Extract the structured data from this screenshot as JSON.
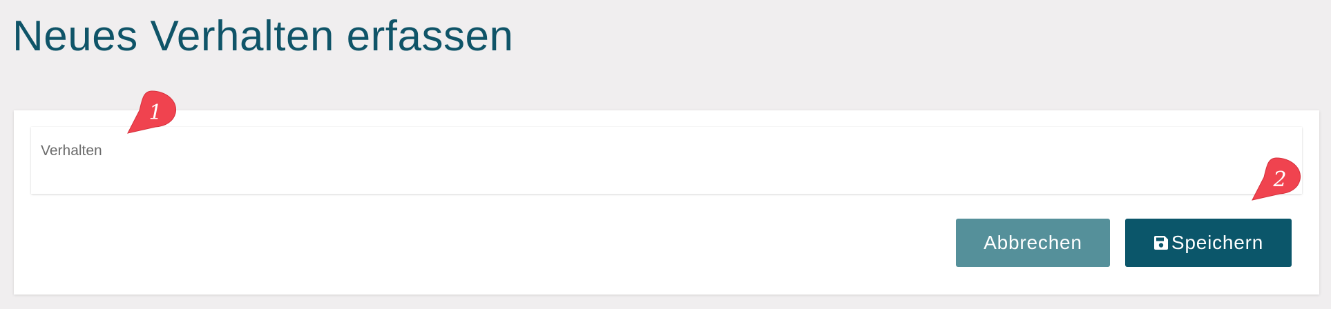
{
  "page": {
    "title": "Neues Verhalten erfassen"
  },
  "form": {
    "field_label": "Verhalten",
    "field_value": ""
  },
  "buttons": {
    "cancel_label": "Abbrechen",
    "save_label": "Speichern",
    "save_icon": "floppy-disk-icon"
  },
  "annotations": [
    {
      "number": "1",
      "target": "verhalten-field"
    },
    {
      "number": "2",
      "target": "save-button"
    }
  ],
  "colors": {
    "background": "#f0eeef",
    "title": "#0f5468",
    "cancel_button": "#55909a",
    "save_button": "#0b566a",
    "marker": "#f0434f"
  }
}
